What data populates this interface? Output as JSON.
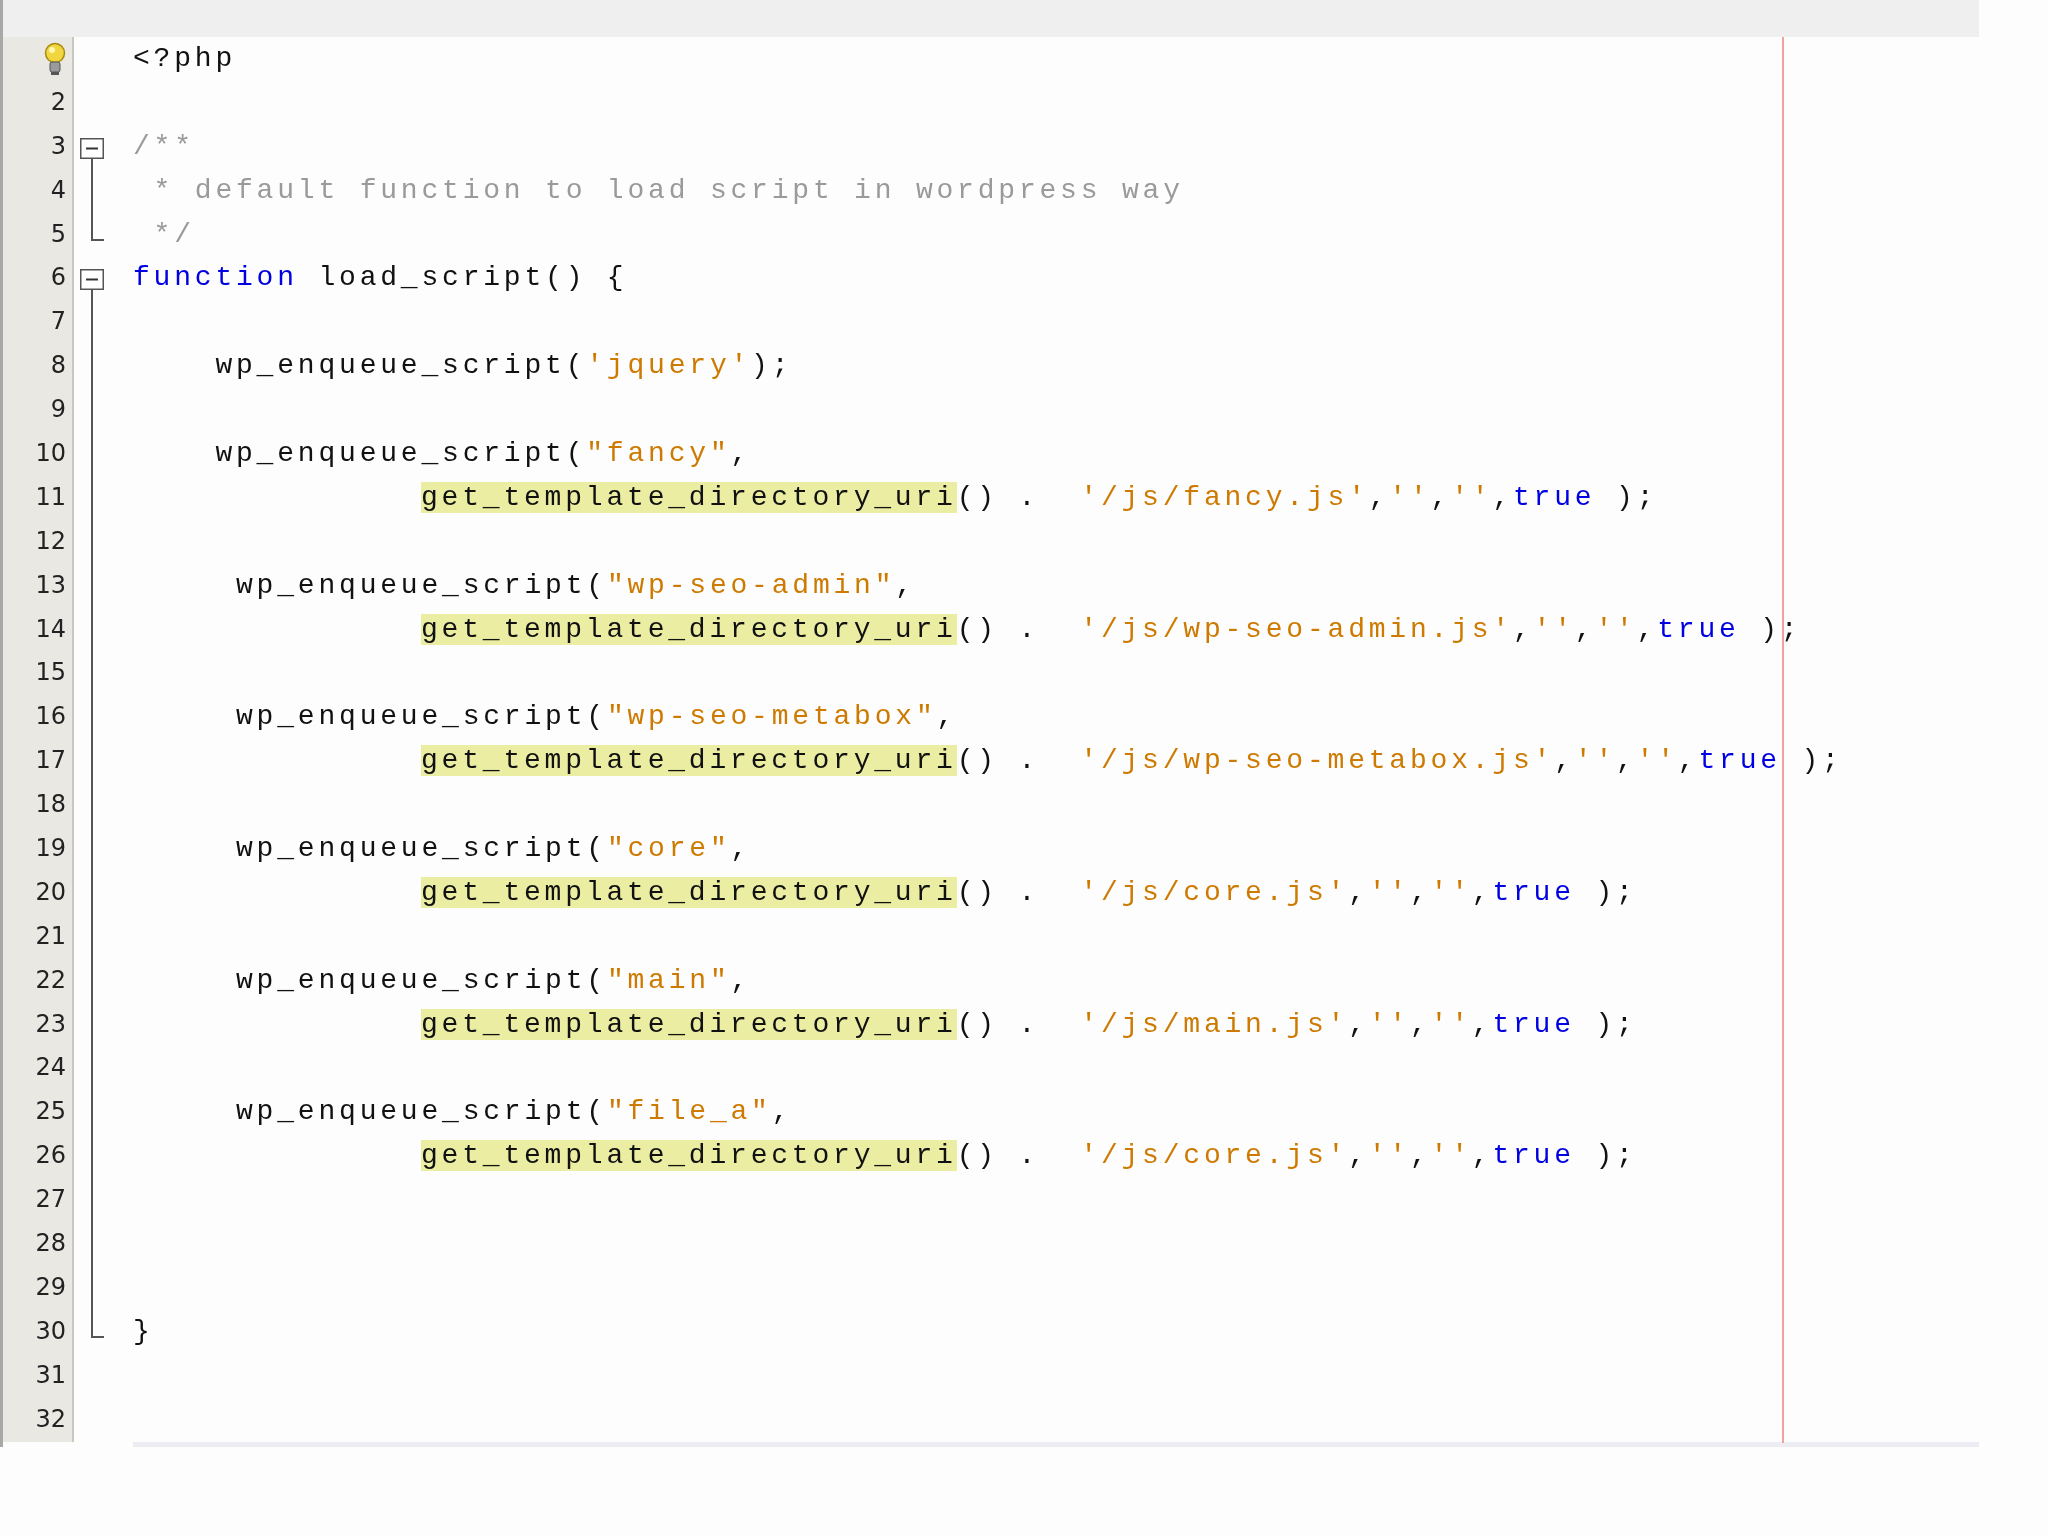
{
  "lines": [
    {
      "hint": true,
      "kind": "plain",
      "tokens": [
        {
          "kind": "plain",
          "text": "<?php"
        }
      ]
    },
    {
      "number": "2",
      "hint": false,
      "kind": "plain"
    },
    {
      "number": "3",
      "hint": false,
      "kind": "fold_start",
      "expanded": true,
      "tokens": [
        {
          "kind": "comment",
          "text": "/**"
        }
      ]
    },
    {
      "number": "4",
      "hint": false,
      "kind": "fold_body",
      "tokens": [
        {
          "kind": "comment",
          "text": " * default function to load script in wordpress way"
        }
      ]
    },
    {
      "number": "5",
      "hint": false,
      "kind": "fold_end",
      "tokens": [
        {
          "kind": "comment",
          "text": " */"
        }
      ]
    },
    {
      "number": "6",
      "hint": false,
      "kind": "fold_start",
      "expanded": true,
      "tokens": [
        {
          "kind": "keyword",
          "text": "function"
        },
        {
          "kind": "plain",
          "text": " load_script() {"
        }
      ]
    },
    {
      "number": "7",
      "hint": false,
      "kind": "fold_body"
    },
    {
      "number": "8",
      "hint": false,
      "kind": "fold_body",
      "tokens": [
        {
          "kind": "plain",
          "text": "    wp_enqueue_script("
        },
        {
          "kind": "string",
          "text": "'jquery'"
        },
        {
          "kind": "plain",
          "text": ");"
        }
      ]
    },
    {
      "number": "9",
      "hint": false,
      "kind": "fold_body"
    },
    {
      "number": "10",
      "hint": false,
      "kind": "fold_body",
      "tokens": [
        {
          "kind": "plain",
          "text": "    wp_enqueue_script("
        },
        {
          "kind": "string",
          "text": "\"fancy\""
        },
        {
          "kind": "plain",
          "text": ","
        }
      ]
    },
    {
      "number": "11",
      "hint": false,
      "kind": "fold_body",
      "continuation": true,
      "tokens": [
        {
          "kind": "highlight",
          "text": "get_template_directory_uri"
        },
        {
          "kind": "plain",
          "text": "() .  "
        },
        {
          "kind": "string",
          "text": "'/js/fancy.js'"
        },
        {
          "kind": "plain",
          "text": ","
        },
        {
          "kind": "string",
          "text": "''"
        },
        {
          "kind": "plain",
          "text": ","
        },
        {
          "kind": "string",
          "text": "''"
        },
        {
          "kind": "plain",
          "text": ","
        },
        {
          "kind": "keyword",
          "text": "true"
        },
        {
          "kind": "plain",
          "text": " );"
        }
      ]
    },
    {
      "number": "12",
      "hint": false,
      "kind": "fold_body"
    },
    {
      "number": "13",
      "hint": false,
      "kind": "fold_body",
      "tokens": [
        {
          "kind": "plain",
          "text": "     wp_enqueue_script("
        },
        {
          "kind": "string",
          "text": "\"wp-seo-admin\""
        },
        {
          "kind": "plain",
          "text": ","
        }
      ]
    },
    {
      "number": "14",
      "hint": false,
      "kind": "fold_body",
      "continuation": true,
      "tokens": [
        {
          "kind": "highlight",
          "text": "get_template_directory_uri"
        },
        {
          "kind": "plain",
          "text": "() .  "
        },
        {
          "kind": "string",
          "text": "'/js/wp-seo-admin.js'"
        },
        {
          "kind": "plain",
          "text": ","
        },
        {
          "kind": "string",
          "text": "''"
        },
        {
          "kind": "plain",
          "text": ","
        },
        {
          "kind": "string",
          "text": "''"
        },
        {
          "kind": "plain",
          "text": ","
        },
        {
          "kind": "keyword",
          "text": "true"
        },
        {
          "kind": "plain",
          "text": " );"
        }
      ]
    },
    {
      "number": "15",
      "hint": false,
      "kind": "fold_body"
    },
    {
      "number": "16",
      "hint": false,
      "kind": "fold_body",
      "tokens": [
        {
          "kind": "plain",
          "text": "     wp_enqueue_script("
        },
        {
          "kind": "string",
          "text": "\"wp-seo-metabox\""
        },
        {
          "kind": "plain",
          "text": ","
        }
      ]
    },
    {
      "number": "17",
      "hint": false,
      "kind": "fold_body",
      "continuation": true,
      "tokens": [
        {
          "kind": "highlight",
          "text": "get_template_directory_uri"
        },
        {
          "kind": "plain",
          "text": "() .  "
        },
        {
          "kind": "string",
          "text": "'/js/wp-seo-metabox.js'"
        },
        {
          "kind": "plain",
          "text": ","
        },
        {
          "kind": "string",
          "text": "''"
        },
        {
          "kind": "plain",
          "text": ","
        },
        {
          "kind": "string",
          "text": "''"
        },
        {
          "kind": "plain",
          "text": ","
        },
        {
          "kind": "keyword",
          "text": "true"
        },
        {
          "kind": "plain",
          "text": " );"
        }
      ]
    },
    {
      "number": "18",
      "hint": false,
      "kind": "fold_body"
    },
    {
      "number": "19",
      "hint": false,
      "kind": "fold_body",
      "tokens": [
        {
          "kind": "plain",
          "text": "     wp_enqueue_script("
        },
        {
          "kind": "string",
          "text": "\"core\""
        },
        {
          "kind": "plain",
          "text": ","
        }
      ]
    },
    {
      "number": "20",
      "hint": false,
      "kind": "fold_body",
      "continuation": true,
      "tokens": [
        {
          "kind": "highlight",
          "text": "get_template_directory_uri"
        },
        {
          "kind": "plain",
          "text": "() .  "
        },
        {
          "kind": "string",
          "text": "'/js/core.js'"
        },
        {
          "kind": "plain",
          "text": ","
        },
        {
          "kind": "string",
          "text": "''"
        },
        {
          "kind": "plain",
          "text": ","
        },
        {
          "kind": "string",
          "text": "''"
        },
        {
          "kind": "plain",
          "text": ","
        },
        {
          "kind": "keyword",
          "text": "true"
        },
        {
          "kind": "plain",
          "text": " );"
        }
      ]
    },
    {
      "number": "21",
      "hint": false,
      "kind": "fold_body"
    },
    {
      "number": "22",
      "hint": false,
      "kind": "fold_body",
      "tokens": [
        {
          "kind": "plain",
          "text": "     wp_enqueue_script("
        },
        {
          "kind": "string",
          "text": "\"main\""
        },
        {
          "kind": "plain",
          "text": ","
        }
      ]
    },
    {
      "number": "23",
      "hint": false,
      "kind": "fold_body",
      "continuation": true,
      "tokens": [
        {
          "kind": "highlight",
          "text": "get_template_directory_uri"
        },
        {
          "kind": "plain",
          "text": "() .  "
        },
        {
          "kind": "string",
          "text": "'/js/main.js'"
        },
        {
          "kind": "plain",
          "text": ","
        },
        {
          "kind": "string",
          "text": "''"
        },
        {
          "kind": "plain",
          "text": ","
        },
        {
          "kind": "string",
          "text": "''"
        },
        {
          "kind": "plain",
          "text": ","
        },
        {
          "kind": "keyword",
          "text": "true"
        },
        {
          "kind": "plain",
          "text": " );"
        }
      ]
    },
    {
      "number": "24",
      "hint": false,
      "kind": "fold_body"
    },
    {
      "number": "25",
      "hint": false,
      "kind": "fold_body",
      "tokens": [
        {
          "kind": "plain",
          "text": "     wp_enqueue_script("
        },
        {
          "kind": "string",
          "text": "\"file_a\""
        },
        {
          "kind": "plain",
          "text": ","
        }
      ]
    },
    {
      "number": "26",
      "hint": false,
      "kind": "fold_body",
      "continuation": true,
      "tokens": [
        {
          "kind": "highlight",
          "text": "get_template_directory_uri"
        },
        {
          "kind": "plain",
          "text": "() .  "
        },
        {
          "kind": "string",
          "text": "'/js/core.js'"
        },
        {
          "kind": "plain",
          "text": ","
        },
        {
          "kind": "string",
          "text": "''"
        },
        {
          "kind": "plain",
          "text": ","
        },
        {
          "kind": "string",
          "text": "''"
        },
        {
          "kind": "plain",
          "text": ","
        },
        {
          "kind": "keyword",
          "text": "true"
        },
        {
          "kind": "plain",
          "text": " );"
        }
      ]
    },
    {
      "number": "27",
      "hint": false,
      "kind": "fold_body"
    },
    {
      "number": "28",
      "hint": false,
      "kind": "fold_body"
    },
    {
      "number": "29",
      "hint": false,
      "kind": "fold_body"
    },
    {
      "number": "30",
      "hint": false,
      "kind": "fold_end",
      "tokens": [
        {
          "kind": "plain",
          "text": "}"
        }
      ]
    },
    {
      "number": "31",
      "hint": false,
      "kind": "plain"
    },
    {
      "number": "32",
      "hint": false,
      "kind": "plain"
    }
  ]
}
